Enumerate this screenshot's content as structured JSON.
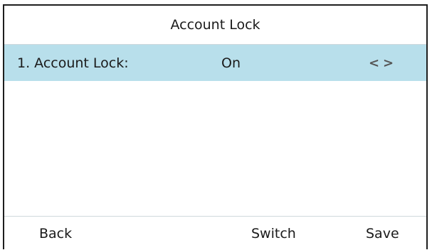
{
  "header": {
    "title": "Account Lock"
  },
  "setting": {
    "label": "1. Account Lock:",
    "value": "On",
    "prev_glyph": "<",
    "next_glyph": ">"
  },
  "softkeys": {
    "back": "Back",
    "switch": "Switch",
    "save": "Save"
  },
  "colors": {
    "highlight": "#b8dfeb",
    "border": "#1e1e1e"
  },
  "icons": [
    "chevron-left-icon",
    "chevron-right-icon"
  ]
}
